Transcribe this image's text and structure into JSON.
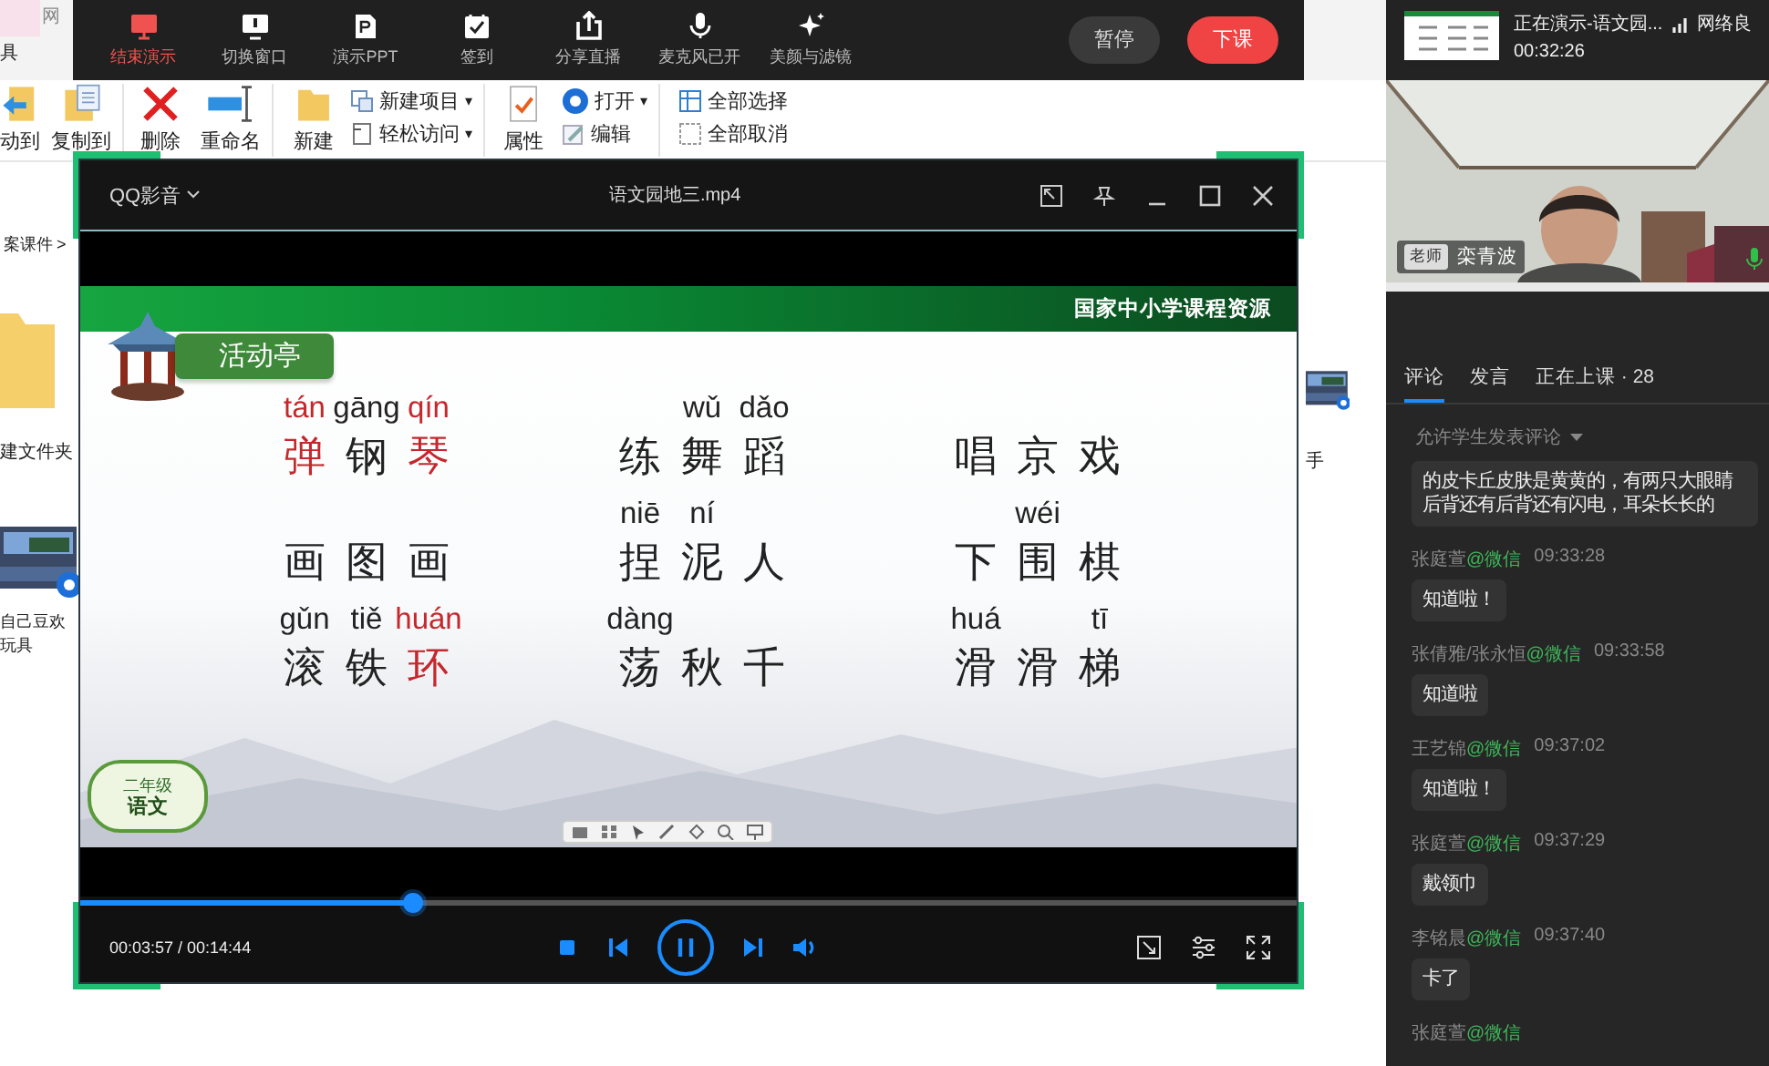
{
  "explorer": {
    "tab": "网",
    "cut_label": "具",
    "ribbon": [
      {
        "label": "动到"
      },
      {
        "label": "复制到"
      },
      {
        "label": "删除"
      },
      {
        "label": "重命名"
      },
      {
        "label": "新建"
      },
      {
        "label": "属性"
      }
    ],
    "small_items": [
      {
        "label": "新建项目",
        "caret": "▾"
      },
      {
        "label": "轻松访问",
        "caret": "▾"
      },
      {
        "label": "打开",
        "caret": "▾"
      },
      {
        "label": "编辑"
      },
      {
        "label": "全部选择"
      },
      {
        "label": "全部取消"
      }
    ],
    "breadcrumb": "案课件",
    "breadcrumb_arrow": ">",
    "desktop_items": [
      {
        "kind": "folder",
        "lines": [
          "建文件夹"
        ]
      },
      {
        "kind": "video",
        "lines": [
          "自己豆欢",
          "玩具"
        ]
      },
      {
        "kind": "video",
        "lines": [
          "手"
        ]
      }
    ]
  },
  "top_toolbar": {
    "items": [
      {
        "label": "结束演示",
        "active": true
      },
      {
        "label": "切换窗口",
        "active": false
      },
      {
        "label": "演示PPT",
        "active": false
      },
      {
        "label": "签到",
        "active": false
      },
      {
        "label": "分享直播",
        "active": false
      },
      {
        "label": "麦克风已开",
        "active": false
      },
      {
        "label": "美颜与滤镜",
        "active": false
      }
    ],
    "pause_button": "暂停",
    "end_button": "下课"
  },
  "player": {
    "app_menu": "QQ影音",
    "title": "语文园地三.mp4",
    "slide": {
      "source": "国家中小学课程资源",
      "section": "活动亭",
      "grade": "二年级",
      "subject": "语文",
      "phrases": [
        [
          {
            "char": "弹",
            "pinyin": "tán",
            "highlighted": true
          },
          {
            "char": "钢",
            "pinyin": "gāng",
            "highlighted": false
          },
          {
            "char": "琴",
            "pinyin": "qín",
            "highlighted": true
          }
        ],
        [
          {
            "char": "练",
            "highlighted": false
          },
          {
            "char": "舞",
            "pinyin": "wǔ",
            "highlighted": false
          },
          {
            "char": "蹈",
            "pinyin": "dǎo",
            "highlighted": false
          }
        ],
        [
          {
            "char": "唱",
            "highlighted": false
          },
          {
            "char": "京",
            "highlighted": false
          },
          {
            "char": "戏",
            "highlighted": false
          }
        ],
        [
          {
            "char": "画",
            "highlighted": false
          },
          {
            "char": "图",
            "highlighted": false
          },
          {
            "char": "画",
            "highlighted": false
          }
        ],
        [
          {
            "char": "捏",
            "pinyin": "niē",
            "highlighted": false
          },
          {
            "char": "泥",
            "pinyin": "ní",
            "highlighted": false
          },
          {
            "char": "人",
            "highlighted": false
          }
        ],
        [
          {
            "char": "下",
            "highlighted": false
          },
          {
            "char": "围",
            "pinyin": "wéi",
            "highlighted": false
          },
          {
            "char": "棋",
            "highlighted": false
          }
        ],
        [
          {
            "char": "滚",
            "pinyin": "gǔn",
            "highlighted": false
          },
          {
            "char": "铁",
            "pinyin": "tiě",
            "highlighted": false
          },
          {
            "char": "环",
            "pinyin": "huán",
            "highlighted": true
          }
        ],
        [
          {
            "char": "荡",
            "pinyin": "dàng",
            "highlighted": false
          },
          {
            "char": "秋",
            "highlighted": false
          },
          {
            "char": "千",
            "highlighted": false
          }
        ],
        [
          {
            "char": "滑",
            "pinyin": "huá",
            "highlighted": false
          },
          {
            "char": "滑",
            "highlighted": false
          },
          {
            "char": "梯",
            "pinyin": "tī",
            "highlighted": false
          }
        ]
      ]
    },
    "progress": {
      "level": 0.266
    },
    "time": "00:03:57 / 00:14:44",
    "playing": true
  },
  "side_panel": {
    "presenting": "正在演示-语文园...",
    "network": "网络良",
    "elapsed": "00:32:26",
    "camera": {
      "role": "老师",
      "name": "栾青波",
      "mic_on": true
    },
    "tabs": [
      {
        "label": "评论",
        "selected": true
      },
      {
        "label": "发言",
        "selected": false
      },
      {
        "label": "正在上课 · 28",
        "selected": false
      }
    ],
    "comment_setting": "允许学生发表评论",
    "messages": [
      {
        "text": "的皮卡丘皮肤是黄黄的，有两只大眼睛后背还有后背还有闪电，耳朵长长的"
      },
      {
        "sender": "张庭萱",
        "via": "@微信",
        "time": "09:33:28",
        "text": "知道啦！"
      },
      {
        "sender": "张倩雅/张永恒",
        "via": "@微信",
        "time": "09:33:58",
        "text": "知道啦"
      },
      {
        "sender": "王艺锦",
        "via": "@微信",
        "time": "09:37:02",
        "text": "知道啦！"
      },
      {
        "sender": "张庭萱",
        "via": "@微信",
        "time": "09:37:29",
        "text": "戴领巾"
      },
      {
        "sender": "李铭晨",
        "via": "@微信",
        "time": "09:37:40",
        "text": "卡了"
      },
      {
        "sender": "张庭萱",
        "via": "@微信"
      }
    ]
  }
}
